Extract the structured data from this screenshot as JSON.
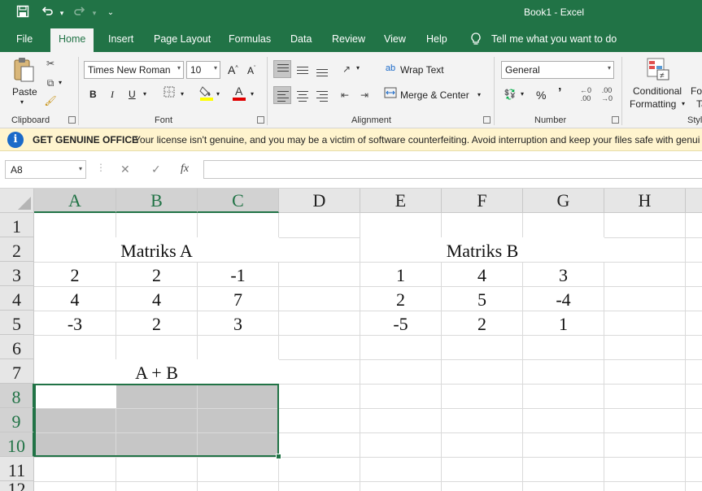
{
  "window": {
    "title": "Book1  -  Excel"
  },
  "quick_access": {
    "save_icon": "save-icon",
    "undo_icon": "undo-icon",
    "redo_icon": "redo-icon",
    "customize_icon": "customize-icon"
  },
  "menu": {
    "tabs": [
      "File",
      "Home",
      "Insert",
      "Page Layout",
      "Formulas",
      "Data",
      "Review",
      "View",
      "Help"
    ],
    "active_tab": "Home",
    "tell_me": "Tell me what you want to do"
  },
  "ribbon": {
    "clipboard": {
      "label": "Clipboard",
      "paste": "Paste"
    },
    "font": {
      "label": "Font",
      "font_name": "Times New Roman",
      "font_size": "10",
      "bold": "B",
      "italic": "I",
      "underline": "U"
    },
    "alignment": {
      "label": "Alignment",
      "wrap_text": "Wrap Text",
      "merge_center": "Merge & Center"
    },
    "number": {
      "label": "Number",
      "format": "General",
      "percent": "%",
      "comma": "’"
    },
    "styles": {
      "conditional_formatting_line1": "Conditional",
      "conditional_formatting_line2": "Formatting",
      "format_as_table_line1": "Fo",
      "format_as_table_line2": "Ta",
      "label": "Styl"
    }
  },
  "license_bar": {
    "heading": "GET GENUINE OFFICE",
    "message": "Your license isn't genuine, and you may be a victim of software counterfeiting. Avoid interruption and keep your files safe with genui"
  },
  "formula_bar": {
    "name_box": "A8",
    "cancel": "✕",
    "enter": "✓",
    "fx": "fx",
    "value": ""
  },
  "sheet": {
    "columns": [
      "A",
      "B",
      "C",
      "D",
      "E",
      "F",
      "G",
      "H"
    ],
    "rows": [
      "1",
      "2",
      "3",
      "4",
      "5",
      "6",
      "7",
      "8",
      "9",
      "10",
      "11",
      "12"
    ],
    "titles": {
      "matrix_a": "Matriks A",
      "matrix_b": "Matriks B",
      "sum": "A + B"
    },
    "matrix_a": [
      [
        "2",
        "2",
        "-1"
      ],
      [
        "4",
        "4",
        "7"
      ],
      [
        "-3",
        "2",
        "3"
      ]
    ],
    "matrix_b": [
      [
        "1",
        "4",
        "3"
      ],
      [
        "2",
        "5",
        "-4"
      ],
      [
        "-5",
        "2",
        "1"
      ]
    ],
    "active_cell": "A8",
    "selection": "A8:C10"
  },
  "colors": {
    "excel_green": "#217346",
    "license_bg": "#fff4ce",
    "selection_gray": "#c6c6c6"
  }
}
